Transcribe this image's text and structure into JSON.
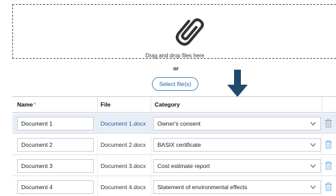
{
  "dropzone": {
    "icon": "paperclip-icon",
    "text": "Drag and drop files here"
  },
  "or_text": "or",
  "select_button": "Select file(s)",
  "arrow": "down-arrow-icon",
  "table": {
    "headers": {
      "name": "Name",
      "required_marker": "*",
      "file": "File",
      "category": "Category"
    },
    "rows": [
      {
        "name": "Document 1",
        "file": "Document 1.docx",
        "category": "Owner's consent"
      },
      {
        "name": "Document 2",
        "file": "Document 2.docx",
        "category": "BASIX certificate"
      },
      {
        "name": "Document 3",
        "file": "Document 3.docx",
        "category": "Cost estimate report"
      },
      {
        "name": "Document 4",
        "file": "Document 4.docx",
        "category": "Statement of environmental effects"
      }
    ]
  },
  "colors": {
    "accent": "#1d5fa0",
    "required": "#e8942a",
    "arrow": "#1f4a6e",
    "row_highlight": "#e8eef8"
  }
}
